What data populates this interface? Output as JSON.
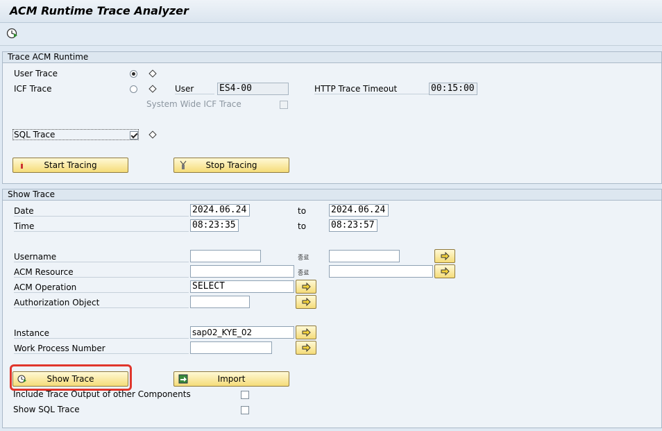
{
  "title": "ACM Runtime Trace Analyzer",
  "toolbar": {
    "execute_icon": "execute-clock-icon"
  },
  "trace_runtime": {
    "header": "Trace ACM Runtime",
    "user_trace_label": "User Trace",
    "user_trace_selected": true,
    "icf_trace_label": "ICF Trace",
    "icf_trace_selected": false,
    "user_label": "User",
    "user_value": "ES4-00",
    "http_timeout_label": "HTTP Trace Timeout",
    "http_timeout_value": "00:15:00",
    "system_wide_label": "System Wide ICF Trace",
    "system_wide_checked": false,
    "sql_trace_label": "SQL Trace",
    "sql_trace_checked": true,
    "start_tracing_label": "Start Tracing",
    "stop_tracing_label": "Stop Tracing"
  },
  "show_trace": {
    "header": "Show Trace",
    "date_label": "Date",
    "date_from": "2024.06.24",
    "date_to_label": "to",
    "date_to": "2024.06.24",
    "time_label": "Time",
    "time_from": "08:23:35",
    "time_to_label": "to",
    "time_to": "08:23:57",
    "username_label": "Username",
    "username_value": "",
    "username_to_label": "종료",
    "username_to_value": "",
    "acm_resource_label": "ACM Resource",
    "acm_resource_value": "",
    "acm_resource_to_label": "종료",
    "acm_resource_to_value": "",
    "acm_operation_label": "ACM Operation",
    "acm_operation_value": "SELECT",
    "auth_object_label": "Authorization Object",
    "auth_object_value": "",
    "instance_label": "Instance",
    "instance_value": "sap02_KYE_02",
    "wp_number_label": "Work Process Number",
    "wp_number_value": "",
    "show_trace_button": "Show Trace",
    "import_button": "Import",
    "include_output_label": "Include Trace Output of other Components",
    "include_output_checked": false,
    "show_sql_label": "Show SQL Trace",
    "show_sql_checked": false
  },
  "colors": {
    "highlight": "#e0362c",
    "button": "#f5dc79"
  }
}
